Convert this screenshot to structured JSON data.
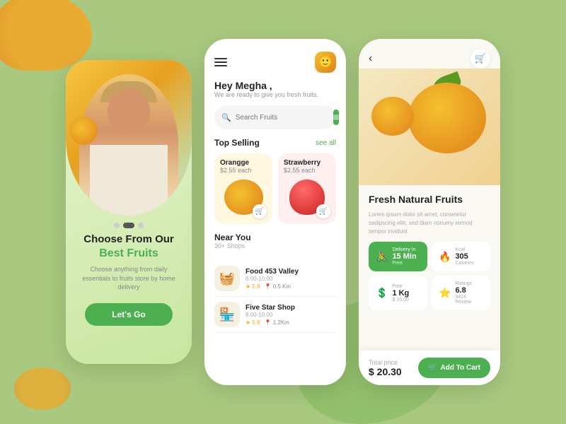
{
  "background": "#a8c97f",
  "phone1": {
    "title": "Choose From Our",
    "highlight": "Best Fruits",
    "description": "Choose anything from daily essentials to fruits store by home delivery",
    "cta": "Let's Go",
    "dots": [
      false,
      true,
      false
    ]
  },
  "phone2": {
    "greeting": "Hey Megha ,",
    "subtitle": "We are ready to give you fresh fruits.",
    "search": {
      "placeholder": "Search Fruits"
    },
    "topSelling": {
      "label": "Top Selling",
      "seeAll": "see all",
      "products": [
        {
          "name": "Orangge",
          "price": "$2.55 each",
          "type": "orange"
        },
        {
          "name": "Strawberry",
          "price": "$2.55 each",
          "type": "strawberry"
        }
      ]
    },
    "nearYou": {
      "label": "Near You",
      "count": "30+ Shops",
      "shops": [
        {
          "name": "Food 453 Valley",
          "hours": "8.00-10.00",
          "rating": "5.8",
          "distance": "0.5 Km"
        },
        {
          "name": "Five Star Shop",
          "hours": "8.00-10.00",
          "rating": "5.8",
          "distance": "1.2Km"
        }
      ]
    }
  },
  "phone3": {
    "fruitName": "Fresh Natural Fruits",
    "description": "Lorem ipsum dolor sit amet, consetetur sadipscing elitr, sed diam nonumy eirmod tempor invidunt",
    "delivery": {
      "label": "Delivery In",
      "time": "15 Min",
      "sub": "Free"
    },
    "calories": {
      "label": "Calories",
      "value": "305"
    },
    "shipping": {
      "label": "Free",
      "weight": "1 Kg",
      "price": "$ 15.00"
    },
    "ratings": {
      "label": "Ratings",
      "value": "6.8",
      "reviews": "3424 Review"
    },
    "totalLabel": "Total price",
    "totalPrice": "$ 20.30",
    "addToCart": "Add To Cart"
  }
}
